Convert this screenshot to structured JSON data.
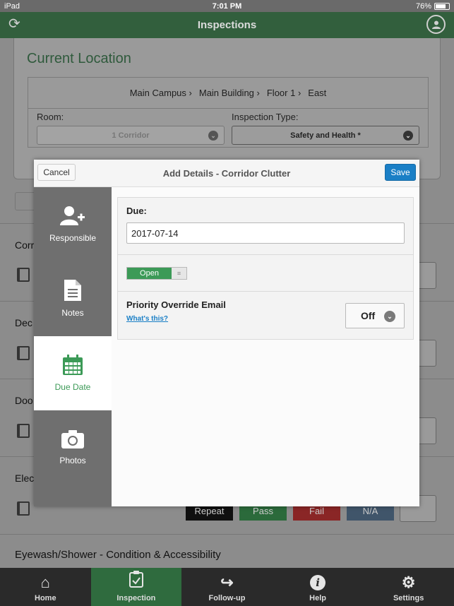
{
  "statusbar": {
    "device": "iPad",
    "time": "7:01 PM",
    "battery": "76%"
  },
  "navbar": {
    "title": "Inspections"
  },
  "location": {
    "title": "Current Location",
    "breadcrumbs": [
      "Main Campus",
      "Main Building",
      "Floor 1",
      "East"
    ],
    "room_label": "Room:",
    "room_value": "1 Corridor",
    "type_label": "Inspection Type:",
    "type_value": "Safety and Health *"
  },
  "list_items": [
    {
      "name": "Corr"
    },
    {
      "name": "Dec"
    },
    {
      "name": "Doo"
    },
    {
      "name": "Elec"
    }
  ],
  "result_buttons": {
    "repeat": "Repeat",
    "pass": "Pass",
    "fail": "Fail",
    "na": "N/A"
  },
  "next_item": "Eyewash/Shower - Condition & Accessibility",
  "modal": {
    "title": "Add Details - Corridor Clutter",
    "cancel": "Cancel",
    "save": "Save",
    "sidebar": [
      {
        "label": "Responsible",
        "icon": "add-user-icon"
      },
      {
        "label": "Notes",
        "icon": "notes-icon"
      },
      {
        "label": "Due Date",
        "icon": "calendar-icon",
        "active": true
      },
      {
        "label": "Photos",
        "icon": "camera-icon"
      }
    ],
    "due_label": "Due:",
    "due_value": "2017-07-14",
    "status_toggle": "Open",
    "priority_label": "Priority Override Email",
    "whats_this": "What's this?",
    "priority_value": "Off"
  },
  "tabbar": [
    {
      "label": "Home",
      "icon": "home-icon"
    },
    {
      "label": "Inspection",
      "icon": "clipboard-icon",
      "active": true
    },
    {
      "label": "Follow-up",
      "icon": "share-arrow-icon"
    },
    {
      "label": "Help",
      "icon": "info-icon"
    },
    {
      "label": "Settings",
      "icon": "gear-icon"
    }
  ],
  "colors": {
    "green": "#3c9a57",
    "navbar": "#325f3d",
    "blue": "#1a7fc6"
  }
}
